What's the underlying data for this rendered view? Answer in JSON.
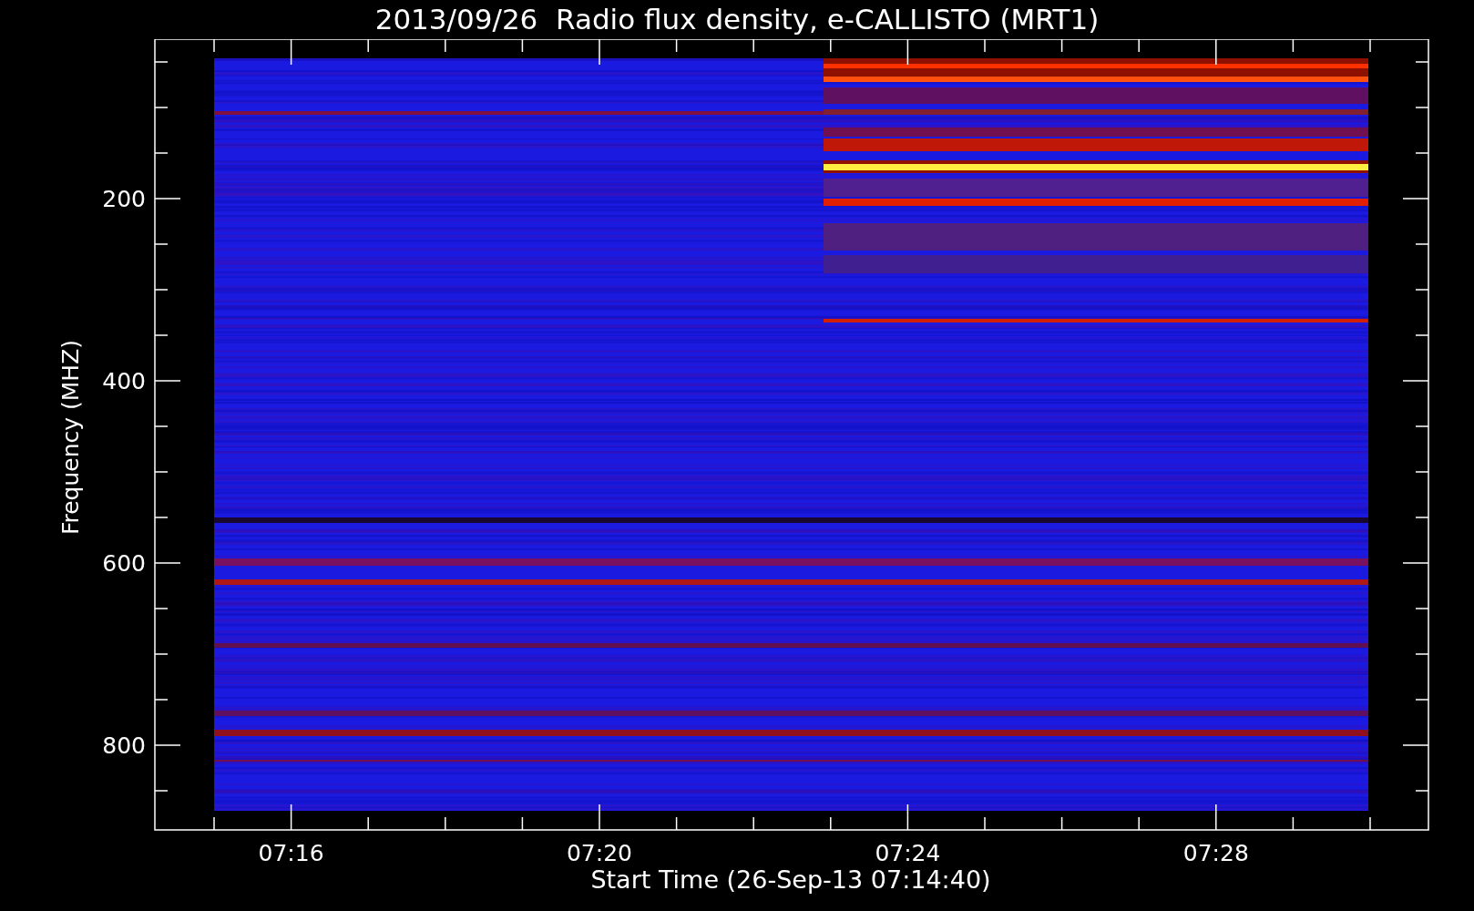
{
  "title": "2013/09/26  Radio flux density, e-CALLISTO (MRT1)",
  "y_axis": {
    "label": "Frequency (MHZ)",
    "ticks": [
      "200",
      "400",
      "600",
      "800"
    ]
  },
  "x_axis": {
    "label": "Start Time (26-Sep-13 07:14:40)",
    "ticks": [
      "07:16",
      "07:20",
      "07:24",
      "07:28"
    ]
  }
}
